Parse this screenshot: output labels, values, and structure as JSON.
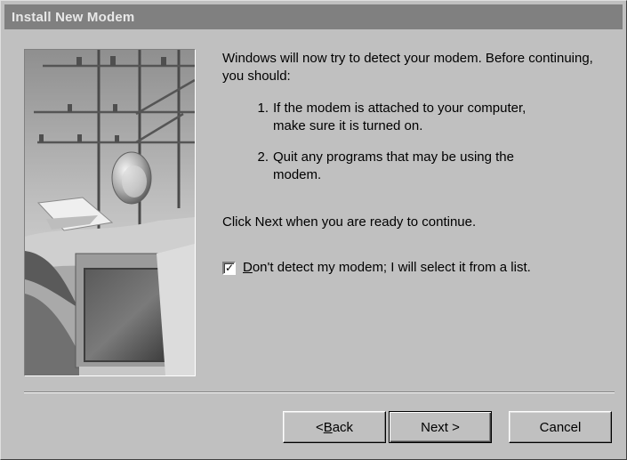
{
  "window": {
    "title": "Install New Modem"
  },
  "image": {
    "icon_name": "modem-wizard-illustration"
  },
  "content": {
    "intro": "Windows will now try to detect your modem.  Before continuing, you should:",
    "steps": [
      {
        "number": "1.",
        "text": "If the modem is attached to your computer, make sure it is turned on."
      },
      {
        "number": "2.",
        "text": "Quit any programs that may be using the modem."
      }
    ],
    "continue_text": "Click Next when you are ready to continue."
  },
  "checkbox": {
    "checked": true,
    "label_mnemonic": "D",
    "label_rest": "on't detect my modem; I will select it from a list."
  },
  "buttons": {
    "back_prefix": "< ",
    "back_mnemonic": "B",
    "back_rest": "ack",
    "next_label": "Next >",
    "cancel_label": "Cancel"
  },
  "colors": {
    "dialog_bg": "#c0c0c0",
    "titlebar_inactive": "#808080",
    "title_text": "#e8e8e8"
  }
}
